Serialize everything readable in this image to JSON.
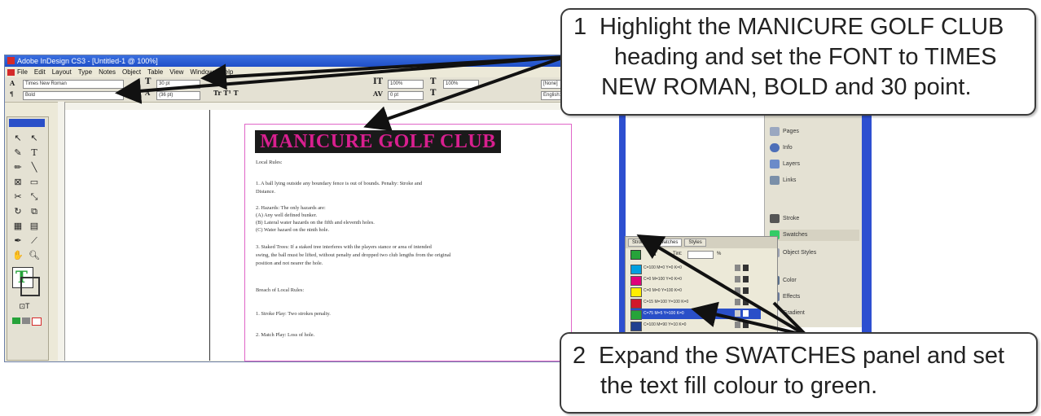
{
  "window": {
    "title": "Adobe InDesign CS3 - [Untitled-1 @ 100%]"
  },
  "menu": [
    "File",
    "Edit",
    "Layout",
    "Type",
    "Notes",
    "Object",
    "Table",
    "View",
    "Window",
    "Help"
  ],
  "control_panel": {
    "font_family": "Times New Roman",
    "font_style": "Bold",
    "font_size": "30 pt",
    "leading": "(36 pt)",
    "scale_h": "100%",
    "scale_v": "100%",
    "tracking": "0",
    "kerning": "0 pt",
    "char_style": "[None]",
    "language": "English: USA"
  },
  "document": {
    "heading": "MANICURE GOLF CLUB",
    "lines": [
      "Local Rules:",
      "1.       A ball lying outside any boundary fence is out of bounds.  Penalty: Stroke and",
      "Distance.",
      "2.       Hazards:  The only hazards are:",
      "          (A)       Any well defined bunker.",
      "          (B)       Lateral water hazards on the fifth and eleventh holes.",
      "          (C)       Water hazard on the ninth hole.",
      "3.       Staked Trees:  If a staked tree interferes with the players stance or area of intended",
      "swing, the ball must be lifted, without penalty and dropped two club lengths from the original",
      "position and not nearer the hole.",
      "Breach of Local Rules:",
      "1.       Stroke Play:  Two strokes penalty.",
      "2.       Match Play:  Loss of hole."
    ]
  },
  "swatches_panel": {
    "tabs": [
      "Stroke",
      "Swatches",
      "Styles"
    ],
    "tint_label": "Tint:",
    "tint_value": "",
    "tint_unit": "%",
    "rows": [
      {
        "name": "C=100 M=0 Y=0 K=0",
        "color": "#00a0e0"
      },
      {
        "name": "C=0 M=100 Y=0 K=0",
        "color": "#e0007a"
      },
      {
        "name": "C=0 M=0 Y=100 K=0",
        "color": "#ffee00"
      },
      {
        "name": "C=15 M=100 Y=100 K=0",
        "color": "#d0182a"
      },
      {
        "name": "C=75 M=5 Y=100 K=0",
        "color": "#26a33a",
        "selected": true
      },
      {
        "name": "C=100 M=90 Y=10 K=0",
        "color": "#213f8f"
      }
    ]
  },
  "dock": {
    "items": [
      "Pages",
      "Info",
      "Layers",
      "Links",
      "Stroke",
      "Swatches",
      "Object Styles",
      "Color",
      "Effects",
      "Gradient"
    ]
  },
  "callouts": {
    "step1": {
      "number": "1",
      "lines": [
        "Highlight the MANICURE GOLF CLUB",
        "heading and set the FONT to TIMES",
        "NEW ROMAN, BOLD and 30 point."
      ]
    },
    "step2": {
      "number": "2",
      "lines": [
        "Expand the SWATCHES panel and set",
        "the text fill colour to green."
      ]
    }
  },
  "colors": {
    "heading_text": "#d81f8f",
    "heading_bg": "#1a1a1a",
    "accent_blue": "#2d4fd0"
  }
}
